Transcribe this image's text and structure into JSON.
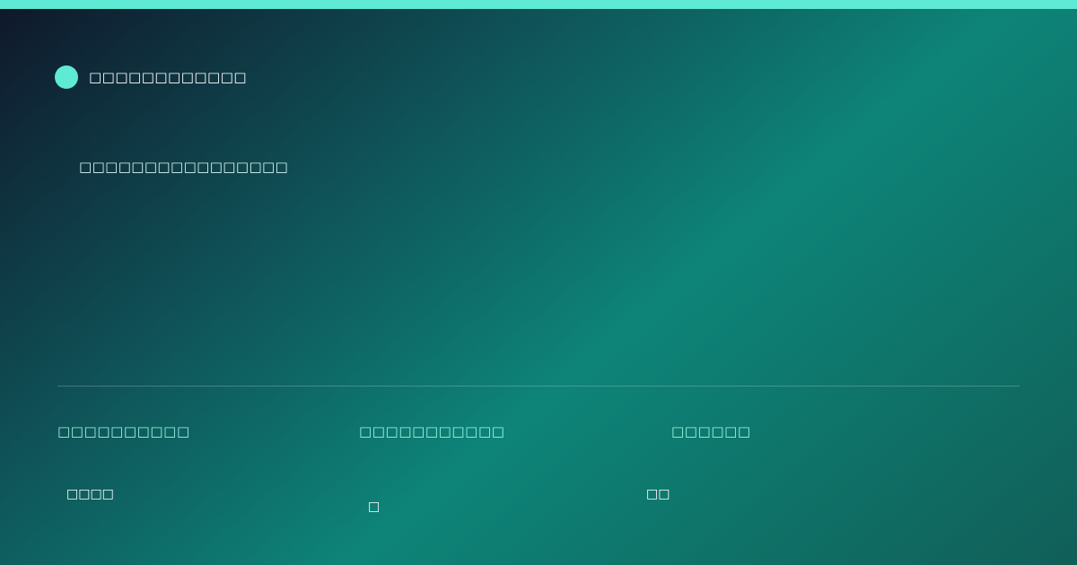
{
  "brand": {
    "name": "□□□□□□□□□□□□"
  },
  "headline": "□□□□□□□□□□□□□□□□",
  "stats": [
    {
      "label": "□□□□□□□□□□",
      "value": "□□□□"
    },
    {
      "label": "□□□□□□□□□□□",
      "value": "□"
    },
    {
      "label": "□□□□□□",
      "value": "□□"
    }
  ],
  "colors": {
    "accent": "#5eead4",
    "label": "#99f6e4",
    "text": "#ffffff"
  }
}
